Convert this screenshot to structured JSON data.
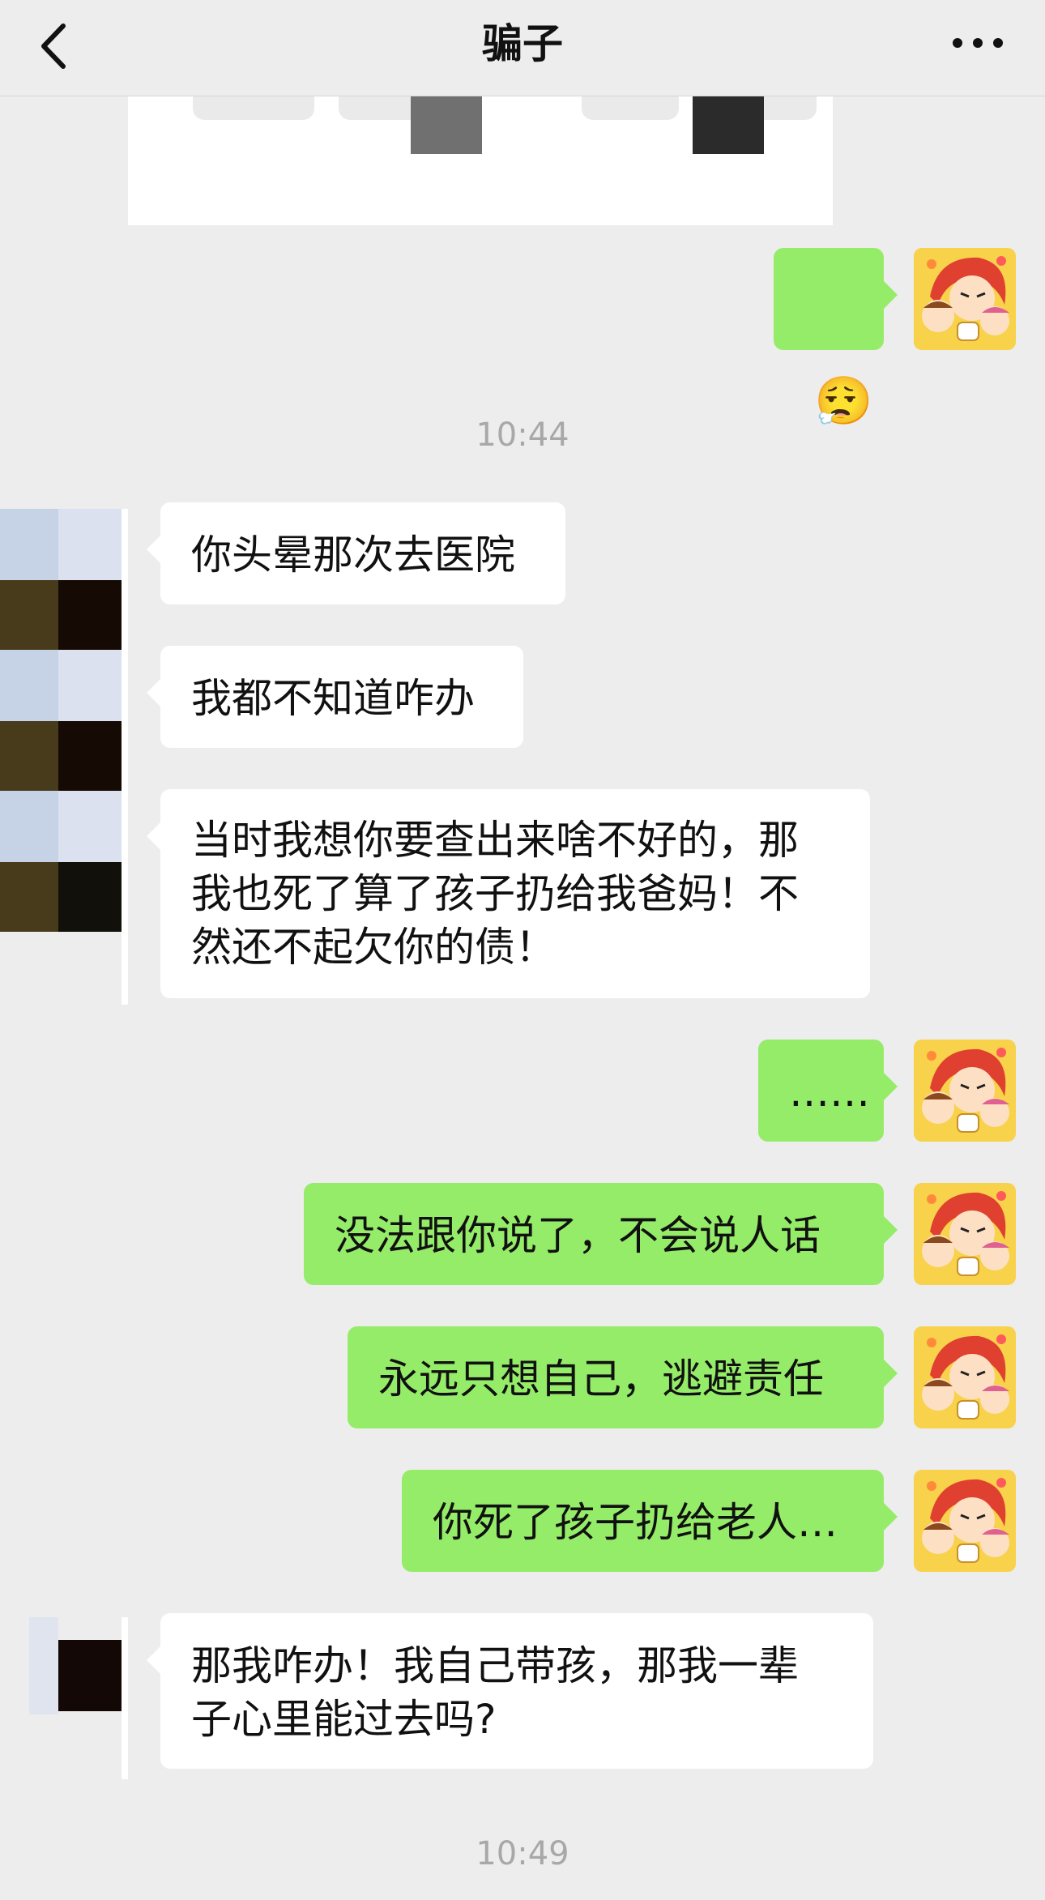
{
  "header": {
    "title": "骗子",
    "back_icon": "chevron-left-icon",
    "more_icon": "more-dots-icon"
  },
  "messages": [
    {
      "side": "right",
      "type": "emoji",
      "emoji": "😮‍💨"
    },
    {
      "type": "time",
      "text": "10:44"
    },
    {
      "side": "left",
      "text": "你头晕那次去医院"
    },
    {
      "side": "left",
      "text": "我都不知道咋办"
    },
    {
      "side": "left",
      "text": "当时我想你要查出来啥不好的，那\n我也死了算了孩子扔给我爸妈！不\n然还不起欠你的债！"
    },
    {
      "side": "right",
      "text": "……"
    },
    {
      "side": "right",
      "text": "没法跟你说了，不会说人话"
    },
    {
      "side": "right",
      "text": "永远只想自己，逃避责任"
    },
    {
      "side": "right",
      "text": "你死了孩子扔给老人…"
    },
    {
      "side": "left",
      "text": "那我咋办！我自己带孩，那我一辈\n子心里能过去吗?"
    },
    {
      "type": "time",
      "text": "10:49"
    }
  ],
  "colors": {
    "background": "#ededed",
    "bubble_self": "#95ec69",
    "bubble_other": "#ffffff",
    "timestamp": "#a8a8a8"
  }
}
